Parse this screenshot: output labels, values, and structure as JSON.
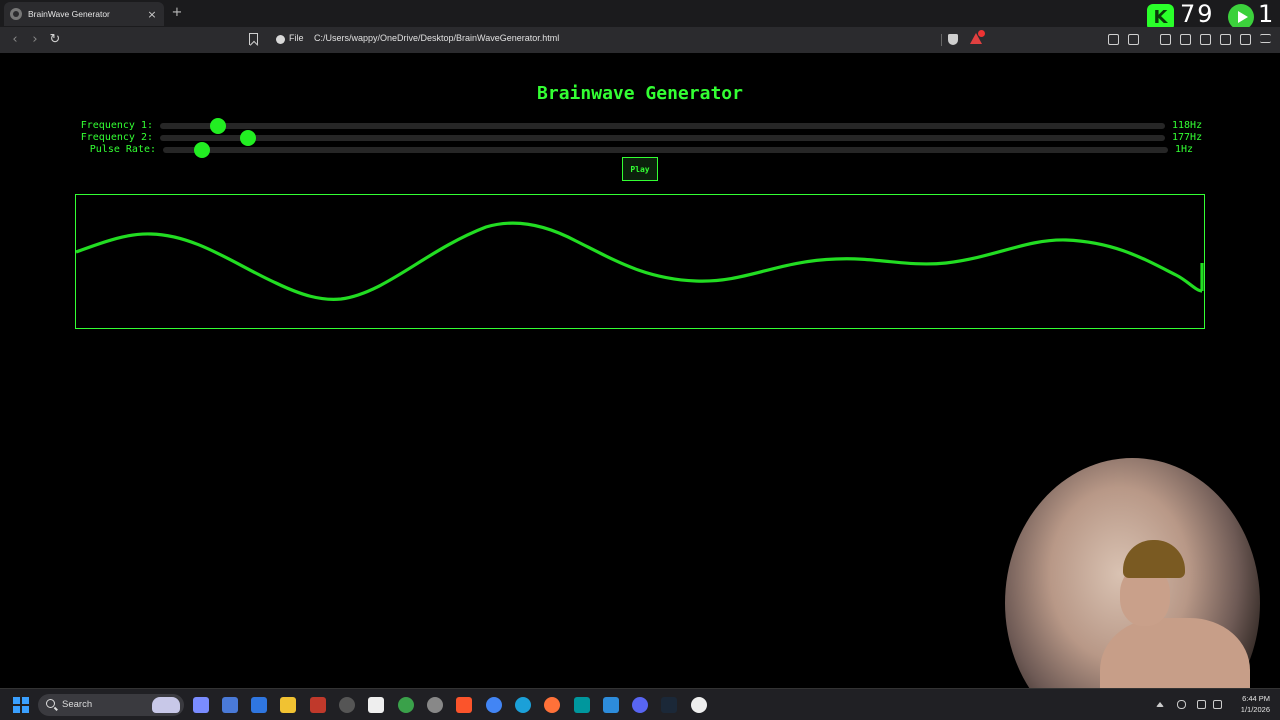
{
  "browser": {
    "tab_title": "BrainWave Generator",
    "tab_close": "×",
    "new_tab": "+",
    "scheme_label": "File",
    "url": "C:/Users/wappy/OneDrive/Desktop/BrainWaveGenerator.html",
    "back": "‹",
    "forward": "›",
    "reload": "↻"
  },
  "stream_overlay": {
    "count_left": "79",
    "count_right": "1",
    "k_letter": "K"
  },
  "app": {
    "title": "Brainwave Generator",
    "controls": [
      {
        "label": "Frequency 1:",
        "value_text": "118Hz",
        "value": 118
      },
      {
        "label": "Frequency 2:",
        "value_text": "177Hz",
        "value": 177
      },
      {
        "label": "Pulse Rate:",
        "value_text": "1Hz",
        "value": 1
      }
    ],
    "play_label": "Play",
    "accent_color": "#33ff33"
  },
  "taskbar": {
    "search_placeholder": "Search",
    "time": "6:44 PM",
    "date": "1/1/2026"
  }
}
